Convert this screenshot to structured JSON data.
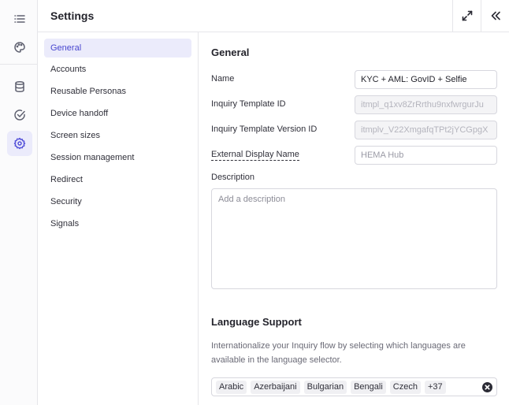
{
  "header": {
    "title": "Settings"
  },
  "sidebar_rail": {
    "icons": [
      "list-icon",
      "palette-icon",
      "database-icon",
      "check-circle-icon",
      "gear-icon"
    ],
    "active": "gear-icon"
  },
  "nav": {
    "items": [
      {
        "label": "General"
      },
      {
        "label": "Accounts"
      },
      {
        "label": "Reusable Personas"
      },
      {
        "label": "Device handoff"
      },
      {
        "label": "Screen sizes"
      },
      {
        "label": "Session management"
      },
      {
        "label": "Redirect"
      },
      {
        "label": "Security"
      },
      {
        "label": "Signals"
      }
    ],
    "active": "General"
  },
  "general": {
    "title": "General",
    "name": {
      "label": "Name",
      "value": "KYC + AML: GovID + Selfie"
    },
    "template_id": {
      "label": "Inquiry Template ID",
      "value": "itmpl_q1xv8ZrRrthu9nxfwrgurJu"
    },
    "template_version_id": {
      "label": "Inquiry Template Version ID",
      "value": "itmplv_V22XmgafqTPt2jYCGpgX"
    },
    "external_display_name": {
      "label": "External Display Name",
      "placeholder": "HEMA Hub"
    },
    "description": {
      "label": "Description",
      "placeholder": "Add a description"
    }
  },
  "language_support": {
    "title": "Language Support",
    "description": "Internationalize your Inquiry flow by selecting which languages are available in the language selector.",
    "tags": [
      "Arabic",
      "Azerbaijani",
      "Bulgarian",
      "Bengali",
      "Czech"
    ],
    "more": "+37"
  },
  "colors": {
    "accent": "#5552d9",
    "accent_bg": "#ebebfb",
    "border": "#e6e6ea"
  }
}
